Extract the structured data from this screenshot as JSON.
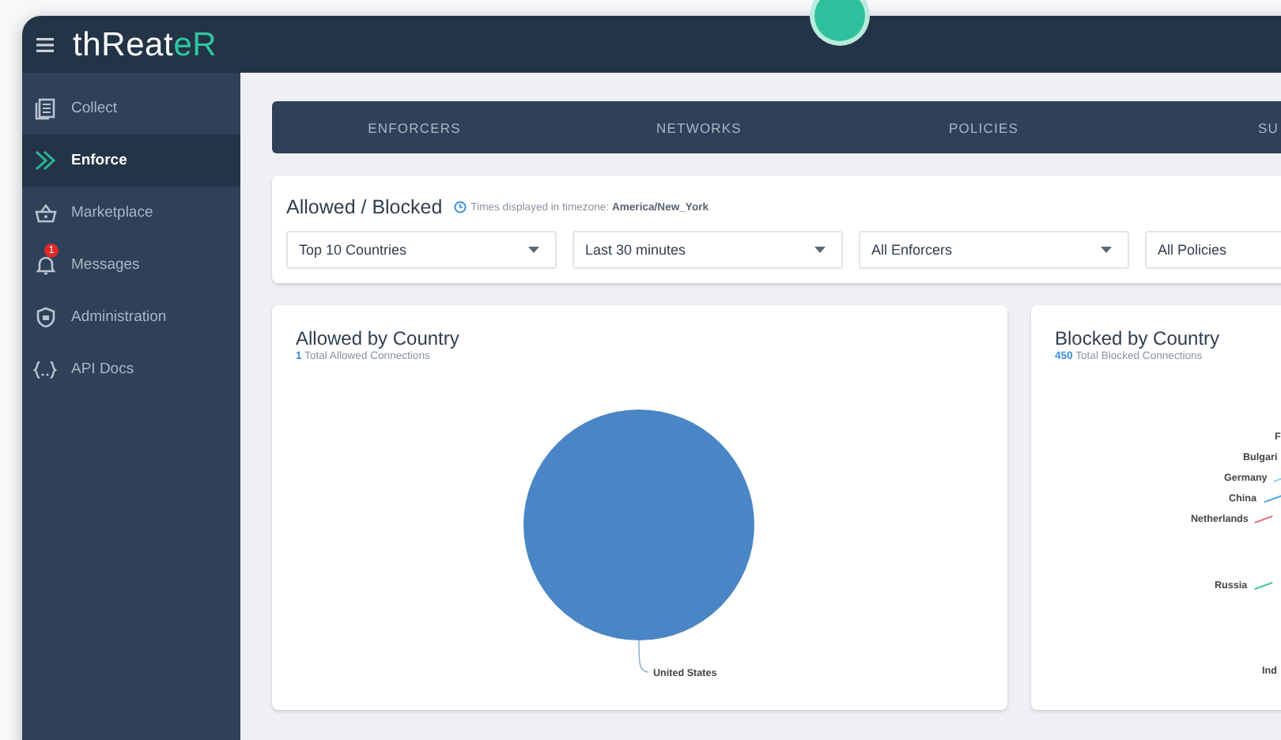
{
  "app": {
    "logo": {
      "text": "thReat",
      "accent": "eR"
    }
  },
  "sidebar": {
    "items": [
      {
        "label": "Collect",
        "selected": false
      },
      {
        "label": "Enforce",
        "selected": true
      },
      {
        "label": "Marketplace",
        "selected": false
      },
      {
        "label": "Messages",
        "selected": false,
        "badge": "1"
      },
      {
        "label": "Administration",
        "selected": false
      },
      {
        "label": "API Docs",
        "selected": false
      }
    ]
  },
  "tabs": [
    {
      "label": "ENFORCERS"
    },
    {
      "label": "NETWORKS"
    },
    {
      "label": "POLICIES"
    },
    {
      "label": "SU"
    }
  ],
  "filters": {
    "title": "Allowed / Blocked",
    "timezone_note": "Times displayed in timezone: **America/New_York**",
    "selects": [
      {
        "value": "Top 10 Countries"
      },
      {
        "value": "Last 30 minutes"
      },
      {
        "value": "All Enforcers"
      },
      {
        "value": "All Policies"
      }
    ]
  },
  "allowed_chart": {
    "title": "Allowed by Country",
    "total": "1",
    "total_label": "Total Allowed Connections",
    "slice_labels": [
      "United States"
    ]
  },
  "blocked_chart": {
    "title": "Blocked by Country",
    "total": "450",
    "total_label": "Total Blocked Connections",
    "labels": [
      {
        "text": "F"
      },
      {
        "text": "Bulgari"
      },
      {
        "text": "Germany",
        "color": "#8fcdf2"
      },
      {
        "text": "China",
        "color": "#4ea6e0"
      },
      {
        "text": "Netherlands",
        "color": "#e8636b"
      },
      {
        "text": "Russia",
        "color": "#3fbf86"
      },
      {
        "text": "Ind"
      }
    ]
  }
}
